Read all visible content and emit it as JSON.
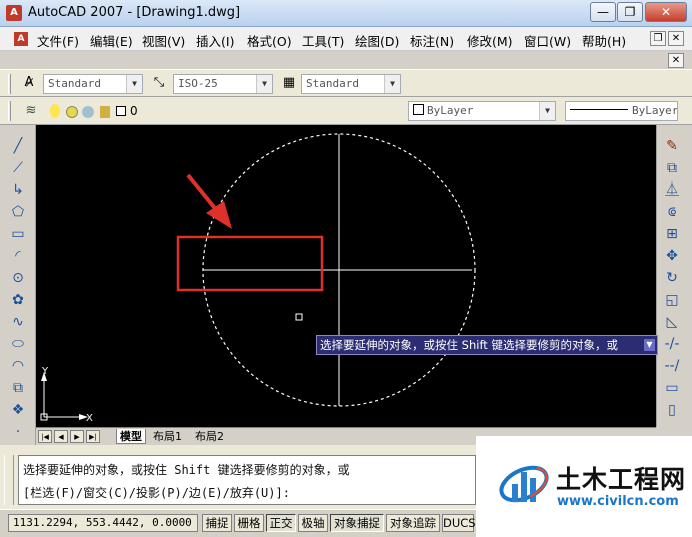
{
  "window": {
    "title": "AutoCAD 2007 - [Drawing1.dwg]",
    "minimize_glyph": "—",
    "restore_glyph": "❐",
    "close_glyph": "✕"
  },
  "menubar": {
    "items": [
      "文件(F)",
      "编辑(E)",
      "视图(V)",
      "插入(I)",
      "格式(O)",
      "工具(T)",
      "绘图(D)",
      "标注(N)",
      "修改(M)",
      "窗口(W)",
      "帮助(H)"
    ]
  },
  "styles_toolbar": {
    "text_style": "Standard",
    "dim_style": "ISO-25",
    "table_style": "Standard"
  },
  "layers_toolbar": {
    "layer_name": "0",
    "color": "ByLayer",
    "linetype": "ByLayer"
  },
  "tabs": {
    "model": "模型",
    "layout1": "布局1",
    "layout2": "布局2"
  },
  "tooltip": {
    "text": "选择要延伸的对象，或按住 Shift 键选择要修剪的对象，或"
  },
  "command": {
    "line1": "选择要延伸的对象，或按住 Shift 键选择要修剪的对象，或",
    "line2": "[栏选(F)/窗交(C)/投影(P)/边(E)/放弃(U)]:"
  },
  "statusbar": {
    "coords": "1131.2294, 553.4442, 0.0000",
    "buttons": [
      {
        "label": "捕捉",
        "on": false
      },
      {
        "label": "栅格",
        "on": false
      },
      {
        "label": "正交",
        "on": true
      },
      {
        "label": "极轴",
        "on": false
      },
      {
        "label": "对象捕捉",
        "on": true
      },
      {
        "label": "对象追踪",
        "on": false
      },
      {
        "label": "DUCS",
        "on": false
      }
    ]
  },
  "ucs": {
    "x_label": "X",
    "y_label": "Y"
  },
  "watermark": {
    "title": "土木工程网",
    "url": "www.civilcn.com"
  },
  "colors": {
    "canvas": "#000000",
    "highlight_box": "#e0302a",
    "tooltip_bg": "#2c2c72",
    "url": "#1976c9"
  }
}
